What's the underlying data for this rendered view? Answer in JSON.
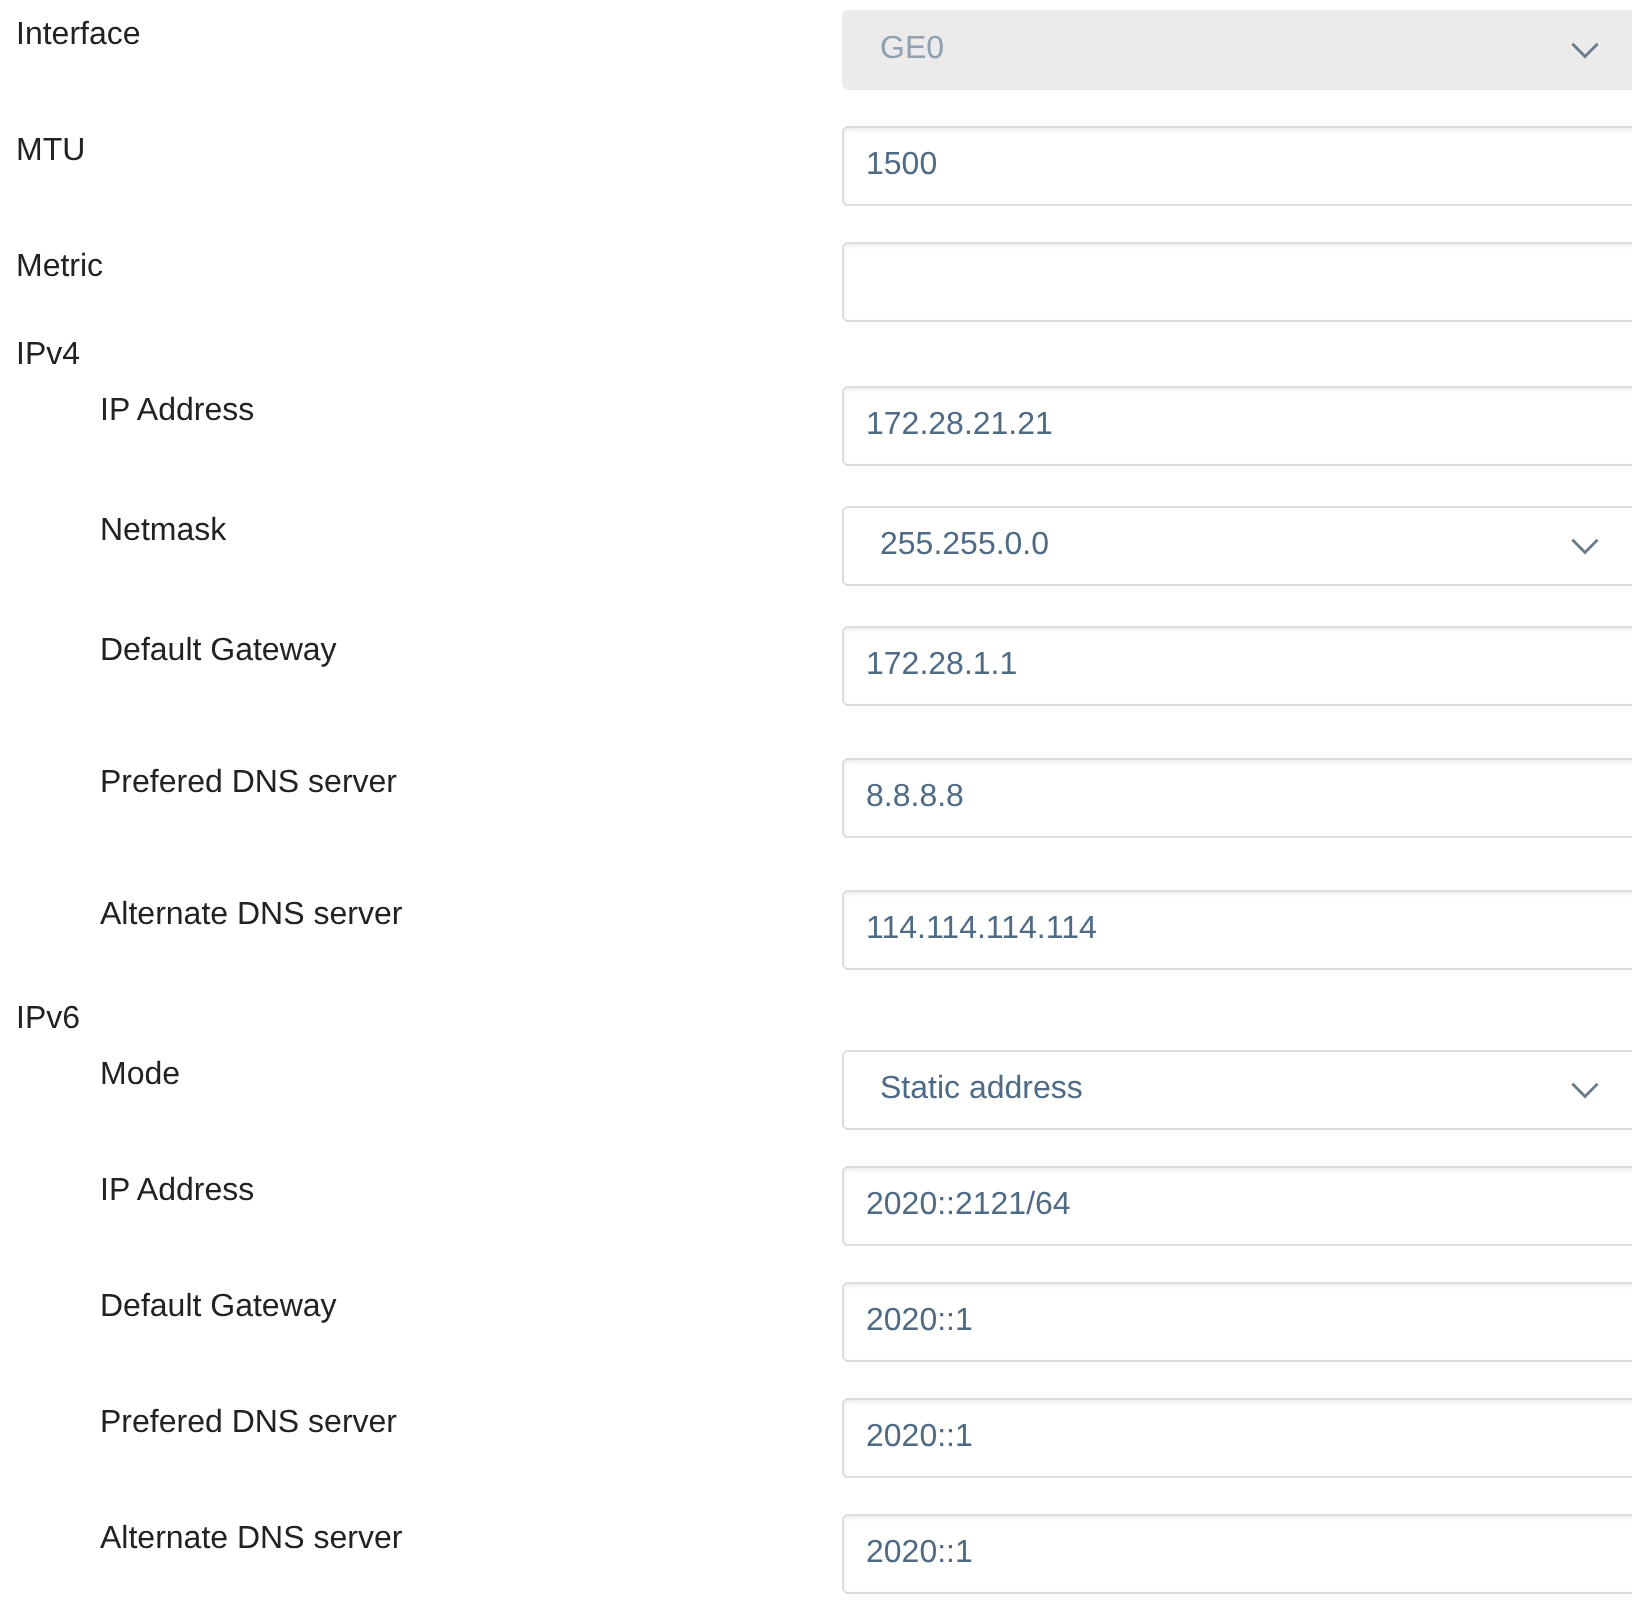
{
  "fields": [
    {
      "label": "Interface",
      "kind": "select",
      "value": "GE0",
      "disabled": true
    },
    {
      "label": "MTU",
      "kind": "input",
      "value": "1500",
      "disabled": false
    },
    {
      "label": "Metric",
      "kind": "input",
      "disabled": false
    }
  ],
  "groups": [
    {
      "title": "IPv4",
      "fields": [
        {
          "label": "IP Address",
          "kind": "input",
          "value": "172.28.21.21",
          "disabled": false
        },
        {
          "label": "Netmask",
          "kind": "select",
          "value": "255.255.0.0",
          "disabled": false
        },
        {
          "label": "Default Gateway",
          "kind": "input",
          "value": "172.28.1.1",
          "disabled": false
        },
        {
          "label": "Prefered DNS server",
          "kind": "input",
          "value": "8.8.8.8",
          "disabled": false
        },
        {
          "label": "Alternate DNS server",
          "kind": "input",
          "value": "114.114.114.114",
          "disabled": false
        }
      ]
    },
    {
      "title": "IPv6",
      "fields": [
        {
          "label": "Mode",
          "kind": "select",
          "value": "Static address",
          "disabled": false
        },
        {
          "label": "IP Address",
          "kind": "input",
          "value": "2020::2121/64",
          "disabled": false
        },
        {
          "label": "Default Gateway",
          "kind": "input",
          "value": "2020::1",
          "disabled": false
        },
        {
          "label": "Prefered DNS server",
          "kind": "input",
          "value": "2020::1",
          "disabled": false
        },
        {
          "label": "Alternate DNS server",
          "kind": "input",
          "value": "2020::1",
          "disabled": false
        }
      ]
    }
  ]
}
